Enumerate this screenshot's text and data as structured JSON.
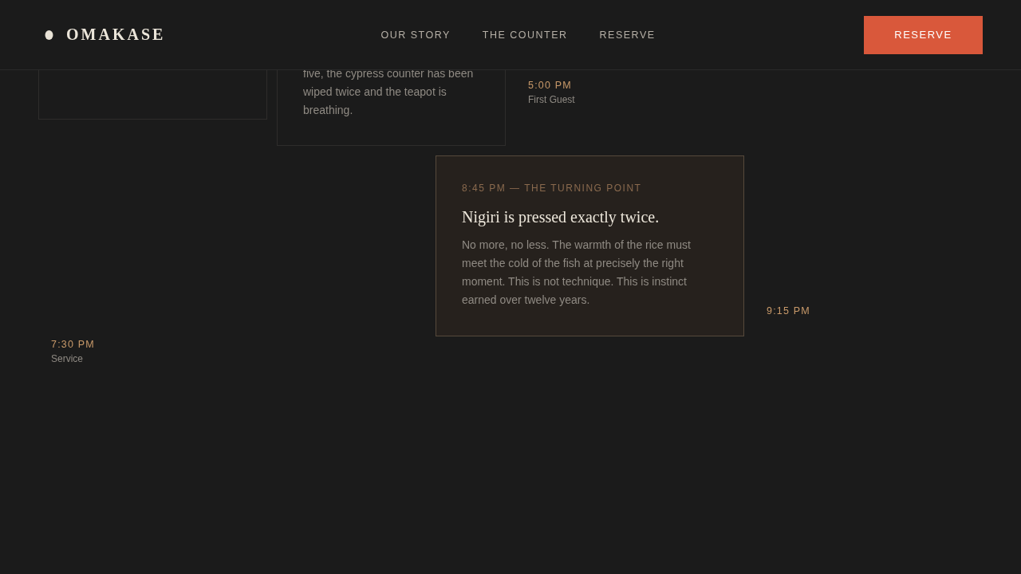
{
  "header": {
    "brand": "OMAKASE",
    "nav": [
      {
        "label": "OUR STORY"
      },
      {
        "label": "THE COUNTER"
      },
      {
        "label": "RESERVE"
      }
    ],
    "cta": "RESERVE"
  },
  "story_cards": [
    {
      "text": "five, the cypress counter has been wiped twice and the teapot is breathing."
    },
    {
      "eyebrow": "8:45 PM — THE TURNING POINT",
      "title": "Nigiri is pressed exactly twice.",
      "text": "No more, no less. The warmth of the rice must meet the cold of the fish at precisely the right moment. This is not technique. This is instinct earned over twelve years."
    }
  ],
  "timeline": [
    {
      "time": "5:00 PM",
      "label": "First Guest"
    },
    {
      "time": "9:15 PM"
    },
    {
      "time": "7:30 PM",
      "label": "Service"
    }
  ]
}
